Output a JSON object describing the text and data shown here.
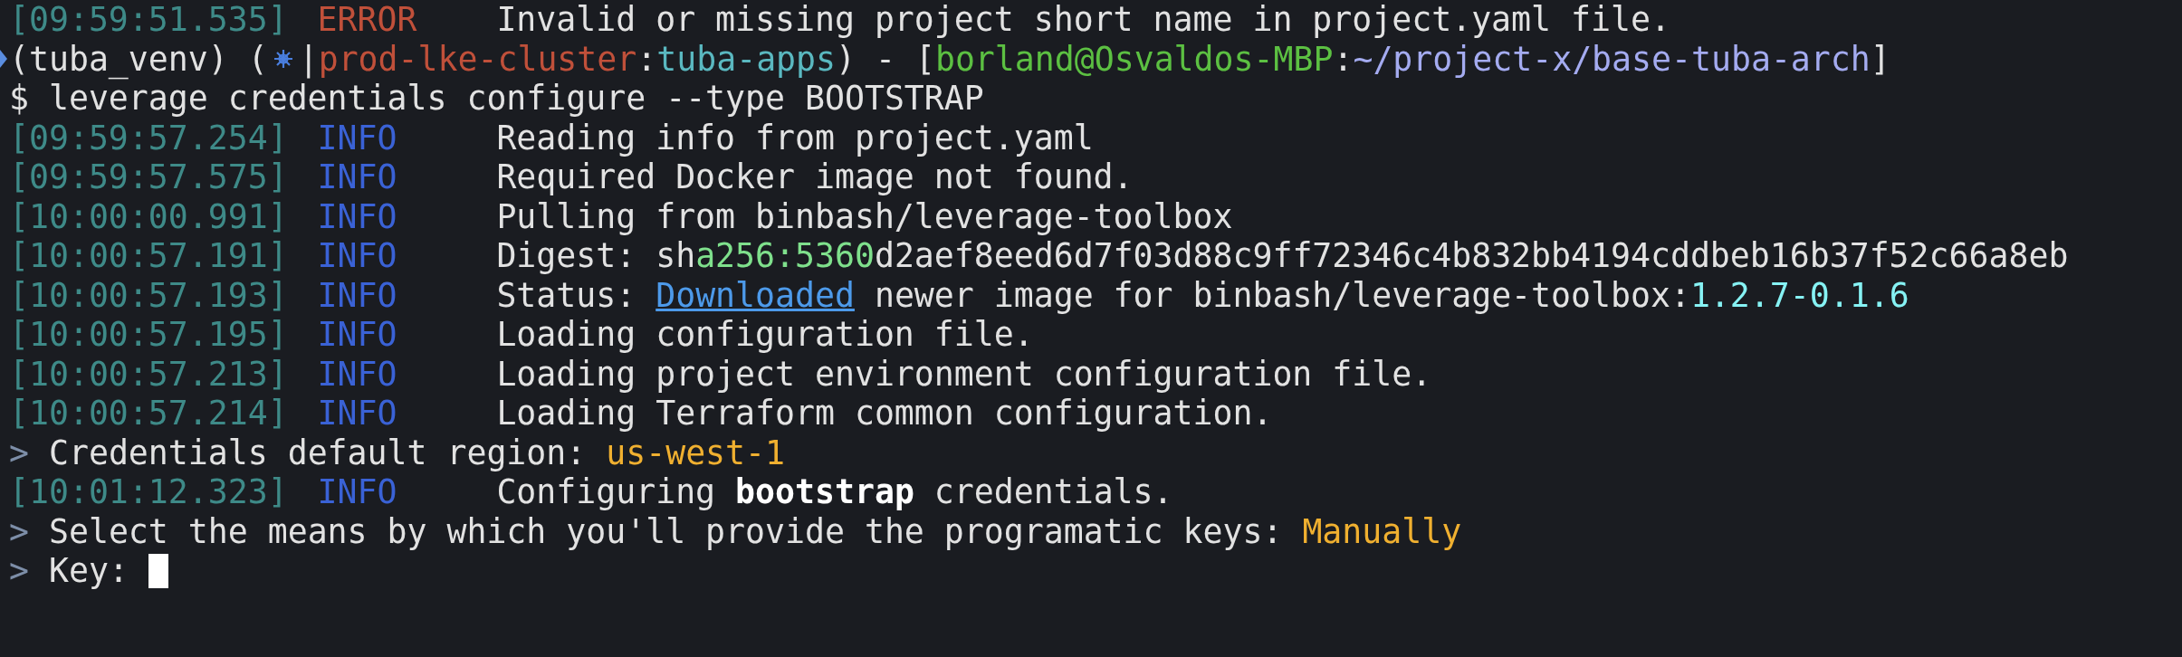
{
  "lines": [
    {
      "kind": "log",
      "time": "[09:59:51.535]",
      "tag": "ERROR",
      "error": true,
      "message": [
        {
          "kind": "plain",
          "text": "Invalid or missing project short name in project.yaml file."
        }
      ]
    },
    {
      "kind": "prompt",
      "segments": [
        {
          "kind": "plain",
          "text": "(tuba_venv) ("
        },
        {
          "kind": "k8s-icon"
        },
        {
          "kind": "plain",
          "text": "|"
        },
        {
          "kind": "context",
          "text": "prod-lke-cluster"
        },
        {
          "kind": "plain",
          "text": ":"
        },
        {
          "kind": "namespace",
          "text": "tuba-apps"
        },
        {
          "kind": "plain",
          "text": ") - ["
        },
        {
          "kind": "user",
          "text": "borland@Osvaldos-MBP"
        },
        {
          "kind": "plain",
          "text": ":"
        },
        {
          "kind": "path",
          "text": "~/project-x/base-tuba-arch"
        },
        {
          "kind": "plain",
          "text": "]"
        }
      ]
    },
    {
      "kind": "command",
      "text": "$ leverage credentials configure --type BOOTSTRAP"
    },
    {
      "kind": "log",
      "time": "[09:59:57.254]",
      "tag": "INFO",
      "error": false,
      "message": [
        {
          "kind": "plain",
          "text": "Reading info from project.yaml"
        }
      ]
    },
    {
      "kind": "log",
      "time": "[09:59:57.575]",
      "tag": "INFO",
      "error": false,
      "message": [
        {
          "kind": "plain",
          "text": "Required Docker image not found."
        }
      ]
    },
    {
      "kind": "log",
      "time": "[10:00:00.991]",
      "tag": "INFO",
      "error": false,
      "message": [
        {
          "kind": "plain",
          "text": "Pulling from binbash/leverage-toolbox"
        }
      ]
    },
    {
      "kind": "log",
      "time": "[10:00:57.191]",
      "tag": "INFO",
      "error": false,
      "message": [
        {
          "kind": "plain",
          "text": "Digest: sh"
        },
        {
          "kind": "hash",
          "text": "a256:5360"
        },
        {
          "kind": "plain",
          "text": "d2aef8eed6d7f03d88c9ff72346c4b832bb4194cddbeb16b37f52c66a8eb"
        }
      ]
    },
    {
      "kind": "log",
      "time": "[10:00:57.193]",
      "tag": "INFO",
      "error": false,
      "message": [
        {
          "kind": "plain",
          "text": "Status: "
        },
        {
          "kind": "link",
          "text": "Downloaded"
        },
        {
          "kind": "plain",
          "text": " newer image for binbash/leverage-toolbox:"
        },
        {
          "kind": "version",
          "text": "1.2.7-0.1.6"
        }
      ]
    },
    {
      "kind": "log",
      "time": "[10:00:57.195]",
      "tag": "INFO",
      "error": false,
      "message": [
        {
          "kind": "plain",
          "text": "Loading configuration file."
        }
      ]
    },
    {
      "kind": "log",
      "time": "[10:00:57.213]",
      "tag": "INFO",
      "error": false,
      "message": [
        {
          "kind": "plain",
          "text": "Loading project environment configuration file."
        }
      ]
    },
    {
      "kind": "log",
      "time": "[10:00:57.214]",
      "tag": "INFO",
      "error": false,
      "message": [
        {
          "kind": "plain",
          "text": "Loading Terraform common configuration."
        }
      ]
    },
    {
      "kind": "question",
      "marker": ">",
      "segments": [
        {
          "kind": "plain",
          "text": "Credentials default region: "
        },
        {
          "kind": "answer",
          "text": "us-west-1"
        }
      ]
    },
    {
      "kind": "log",
      "time": "[10:01:12.323]",
      "tag": "INFO",
      "error": false,
      "message": [
        {
          "kind": "plain",
          "text": "Configuring "
        },
        {
          "kind": "bold",
          "text": "bootstrap"
        },
        {
          "kind": "plain",
          "text": " credentials."
        }
      ]
    },
    {
      "kind": "question",
      "marker": ">",
      "segments": [
        {
          "kind": "plain",
          "text": "Select the means by which you'll provide the programatic keys: "
        },
        {
          "kind": "answer",
          "text": "Manually"
        }
      ]
    },
    {
      "kind": "question",
      "marker": ">",
      "cursor": true,
      "segments": [
        {
          "kind": "plain",
          "text": "Key: "
        }
      ]
    }
  ]
}
